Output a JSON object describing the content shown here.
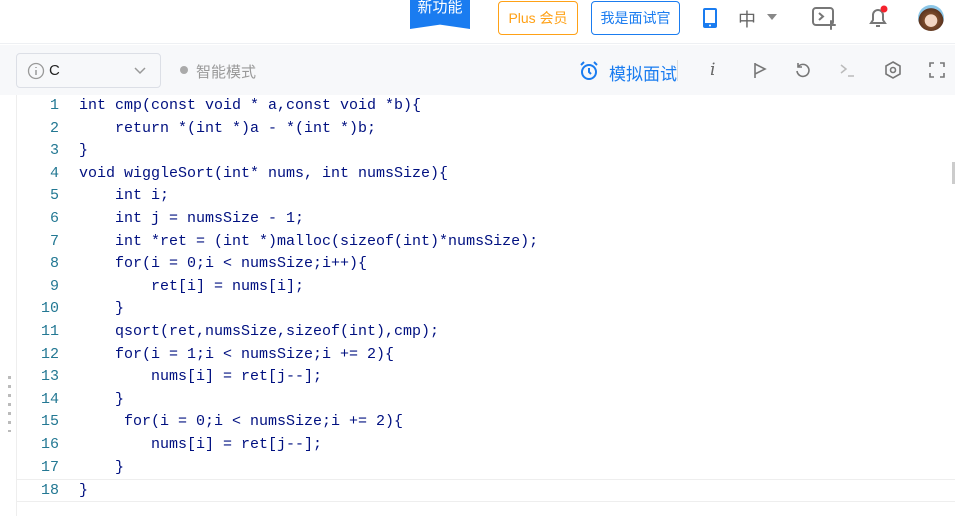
{
  "topbar": {
    "new_feature": "新功能",
    "plus": "Plus 会员",
    "interviewer": "我是面试官",
    "language": "中"
  },
  "toolbar": {
    "language_select": "C",
    "smart_mode": "智能模式",
    "mock_interview": "模拟面试"
  },
  "colors": {
    "accent": "#1a7cf0",
    "plus": "#ffa116",
    "notification": "#f5222d"
  },
  "editor": {
    "lines": [
      "int cmp(const void * a,const void *b){",
      "    return *(int *)a - *(int *)b;",
      "}",
      "void wiggleSort(int* nums, int numsSize){",
      "    int i;",
      "    int j = numsSize - 1;",
      "    int *ret = (int *)malloc(sizeof(int)*numsSize);",
      "    for(i = 0;i < numsSize;i++){",
      "        ret[i] = nums[i];",
      "    }",
      "    qsort(ret,numsSize,sizeof(int),cmp);",
      "    for(i = 1;i < numsSize;i += 2){",
      "        nums[i] = ret[j--];",
      "    }",
      "     for(i = 0;i < numsSize;i += 2){",
      "        nums[i] = ret[j--];",
      "    }",
      "}"
    ]
  }
}
